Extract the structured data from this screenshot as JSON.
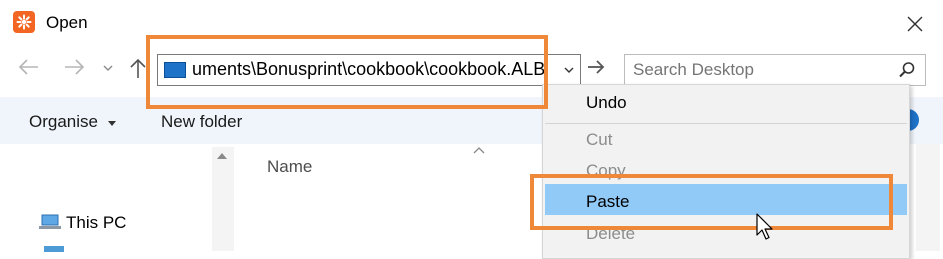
{
  "window": {
    "title": "Open",
    "icon": "app-logo-icon",
    "accent": "#f26522"
  },
  "address_bar": {
    "path": "uments\\Bonusprint\\cookbook\\cookbook.ALB"
  },
  "search": {
    "placeholder": "Search Desktop"
  },
  "toolbar": {
    "organise_label": "Organise",
    "new_folder_label": "New folder"
  },
  "nav_pane": {
    "items": [
      {
        "label": "This PC",
        "icon": "computer-icon"
      }
    ]
  },
  "content": {
    "columns": [
      "Name"
    ]
  },
  "context_menu": {
    "items": [
      {
        "label": "Undo",
        "enabled": true
      },
      {
        "label": "Cut",
        "enabled": false
      },
      {
        "label": "Copy",
        "enabled": false
      },
      {
        "label": "Paste",
        "enabled": true,
        "highlighted": true
      },
      {
        "label": "Delete",
        "enabled": false
      }
    ]
  },
  "colors": {
    "highlight_box": "#f0883a",
    "menu_selection": "#91c9f7",
    "toolbar_bg": "#f0f5fb"
  }
}
